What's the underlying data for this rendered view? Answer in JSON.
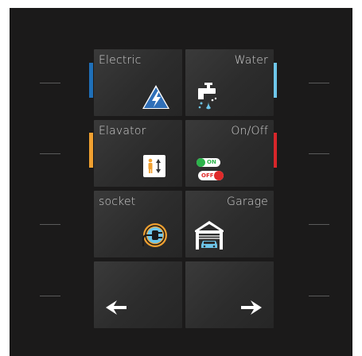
{
  "tiles": {
    "electric": {
      "label": "Electric",
      "icon": "lightning-icon"
    },
    "water": {
      "label": "Water",
      "icon": "faucet-icon"
    },
    "elevator": {
      "label": "Elavator",
      "icon": "elevator-icon"
    },
    "onoff": {
      "label": "On/Off",
      "icon": "toggle-switch-icon",
      "on_text": "ON",
      "off_text": "OFF"
    },
    "socket": {
      "label": "socket",
      "icon": "plug-icon"
    },
    "garage": {
      "label": "Garage",
      "icon": "garage-icon"
    },
    "prev": {
      "label": "",
      "icon": "arrow-left-icon"
    },
    "next": {
      "label": "",
      "icon": "arrow-right-icon"
    }
  },
  "colors": {
    "panel_background": "#1b1a1a",
    "accent_blue": "#1f6fb8",
    "accent_light_blue": "#6ec6ea",
    "accent_orange": "#f0a030",
    "accent_red": "#d8262a",
    "status_on": "#2bb34a",
    "status_off": "#e02a2a"
  }
}
